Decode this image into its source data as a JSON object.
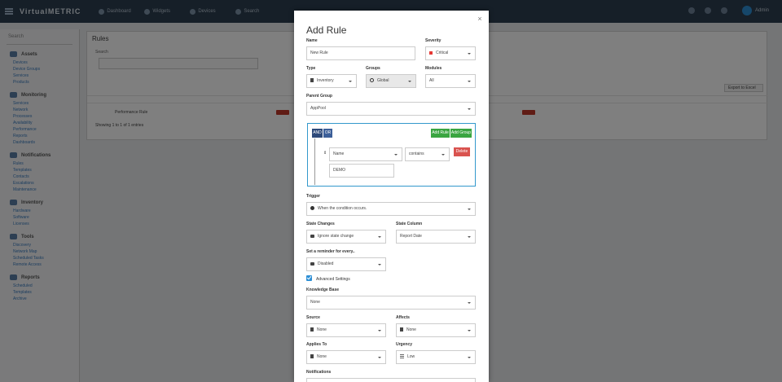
{
  "app": {
    "brand": "VirtualMETRIC",
    "topnav": [
      "Dashboard",
      "Widgets",
      "Devices",
      "Search"
    ],
    "user": "Admin",
    "sidebar": {
      "search": "Search",
      "sections": [
        {
          "title": "Assets",
          "links": [
            "Devices",
            "Device Groups",
            "Services",
            "Products"
          ]
        },
        {
          "title": "Monitoring",
          "links": [
            "Services",
            "Network",
            "Processes",
            "Availability",
            "Performance",
            "Reports",
            "Dashboards"
          ]
        },
        {
          "title": "Notifications",
          "links": [
            "Rules",
            "Templates",
            "Contacts",
            "Escalations",
            "Maintenance"
          ]
        },
        {
          "title": "Inventory",
          "links": [
            "Hardware",
            "Software",
            "Licenses"
          ]
        },
        {
          "title": "Tools",
          "links": [
            "Discovery",
            "Network Map",
            "Scheduled Tasks",
            "Remote Access"
          ]
        },
        {
          "title": "Reports",
          "links": [
            "Scheduled",
            "Templates",
            "Archive"
          ]
        }
      ]
    },
    "main": {
      "title": "Rules",
      "filter_label": "Search",
      "row_name": "Performance Rule",
      "row_state": "Critical",
      "footer": "Showing 1 to 1 of 1 entries",
      "export_label": "Export to Excel"
    }
  },
  "modal": {
    "title": "Add Rule",
    "close": "×",
    "name_label": "Name",
    "name_value": "New Rule",
    "severity_label": "Severity",
    "severity_value": "Critical",
    "type_label": "Type",
    "type_value": "Inventory",
    "groups_label": "Groups",
    "groups_value": "Global",
    "modules_label": "Modules",
    "modules_value": "All",
    "parent_group_label": "Parent Group",
    "parent_group_value": "AppPool",
    "and_label": "AND",
    "or_label": "OR",
    "add_rule_label": "Add Rule",
    "add_group_label": "Add Group",
    "drag_handle": "⇕",
    "field_value": "Name",
    "operator_value": "contains",
    "delete_label": "Delete",
    "condition_value": "DEMO",
    "trigger_label": "Trigger",
    "trigger_value": "When the condition occurs.",
    "state_changes_label": "State Changes",
    "state_changes_value": "Ignore state change",
    "state_column_label": "State Column",
    "state_column_value": "Report Date",
    "reminder_label": "Set a reminder for every..",
    "reminder_value": "Disabled",
    "advanced_label": "Advanced Settings",
    "knowledge_label": "Knowledge Base",
    "knowledge_value": "None",
    "source_label": "Source",
    "source_value": "None",
    "affects_label": "Affects",
    "affects_value": "None",
    "applies_label": "Applies To",
    "applies_value": "None",
    "urgency_label": "Urgency",
    "urgency_value": "Low",
    "notifications_label": "Notifications"
  },
  "colors": {
    "accent": "#2d8fd5",
    "green": "#3aa541",
    "danger": "#d9534f",
    "navy": "#2e4a7a"
  }
}
